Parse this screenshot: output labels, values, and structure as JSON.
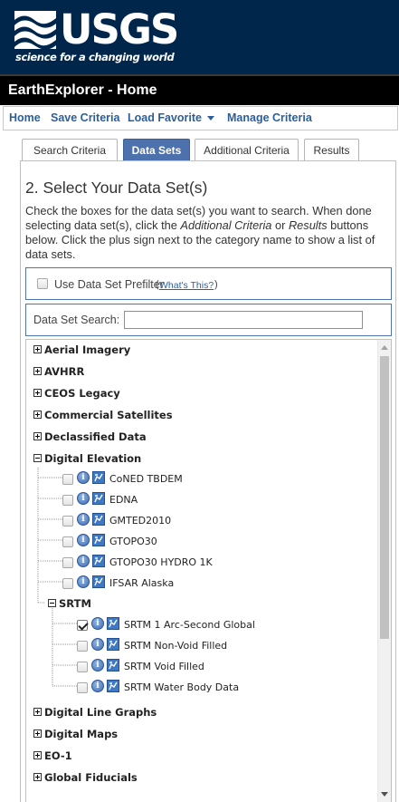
{
  "header": {
    "logo_text": "USGS",
    "tagline": "science for a changing world",
    "app_title": "EarthExplorer - Home"
  },
  "nav": {
    "home": "Home",
    "save_criteria": "Save Criteria",
    "load_favorite": "Load Favorite",
    "manage_criteria": "Manage Criteria"
  },
  "tabs": [
    "Search Criteria",
    "Data Sets",
    "Additional Criteria",
    "Results"
  ],
  "active_tab": "Data Sets",
  "panel": {
    "title": "2. Select Your Data Set(s)",
    "instructions_1": "Check the boxes for the data set(s) you want to search. When done selecting data set(s), click the ",
    "instructions_em1": "Additional Criteria",
    "instructions_2": " or ",
    "instructions_em2": "Results",
    "instructions_3": " buttons below. Click the plus sign next to the category name to show a list of data sets.",
    "prefilter_label": "Use Data Set Prefilter",
    "prefilter_checked": false,
    "whats_this": "What's This?",
    "search_label": "Data Set Search:",
    "search_value": ""
  },
  "tree": {
    "categories_top": [
      "Aerial Imagery",
      "AVHRR",
      "CEOS Legacy",
      "Commercial Satellites",
      "Declassified Data",
      "Digital Elevation"
    ],
    "digital_elevation_items": [
      "CoNED TBDEM",
      "EDNA",
      "GMTED2010",
      "GTOPO30",
      "GTOPO30 HYDRO 1K",
      "IFSAR Alaska"
    ],
    "srtm_label": "SRTM",
    "srtm_items": [
      {
        "label": "SRTM 1 Arc-Second Global",
        "checked": true
      },
      {
        "label": "SRTM Non-Void Filled",
        "checked": false
      },
      {
        "label": "SRTM Void Filled",
        "checked": false
      },
      {
        "label": "SRTM Water Body Data",
        "checked": false
      }
    ],
    "categories_bottom": [
      "Digital Line Graphs",
      "Digital Maps",
      "EO-1",
      "Global Fiducials"
    ]
  },
  "colors": {
    "header_bg": "#00264c",
    "nav_link": "#2b5e9b",
    "active_tab": "#4c71ad"
  }
}
